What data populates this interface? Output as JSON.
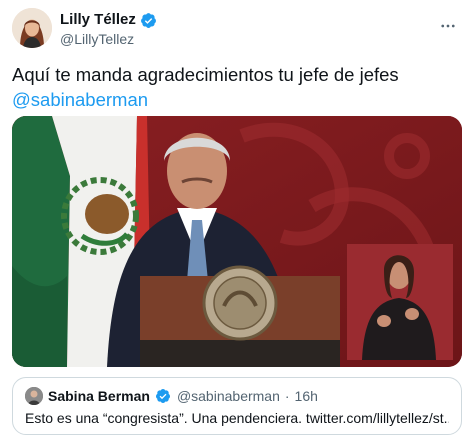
{
  "author": {
    "name": "Lilly Téllez",
    "handle": "@LillyTellez"
  },
  "tweet": {
    "text_line1": "Aquí te manda agradecimientos tu jefe de jefes",
    "mention": "@sabinaberman"
  },
  "media": {
    "podium_seal_text": "ESTADOS UNIDOS MEXICANOS"
  },
  "quoted_tweet": {
    "name": "Sabina Berman",
    "handle": "@sabinaberman",
    "separator": "·",
    "time": "16h",
    "text": "Esto es una “congresista”.  Una pendenciera. twitter.com/lillytellez/st..."
  },
  "colors": {
    "accent": "#1d9bf0",
    "verified": "#1d9bf0",
    "text_secondary": "#536471",
    "border": "#cfd9de"
  },
  "icons": {
    "verified": "verified-badge-icon",
    "more": "more-options-icon"
  }
}
